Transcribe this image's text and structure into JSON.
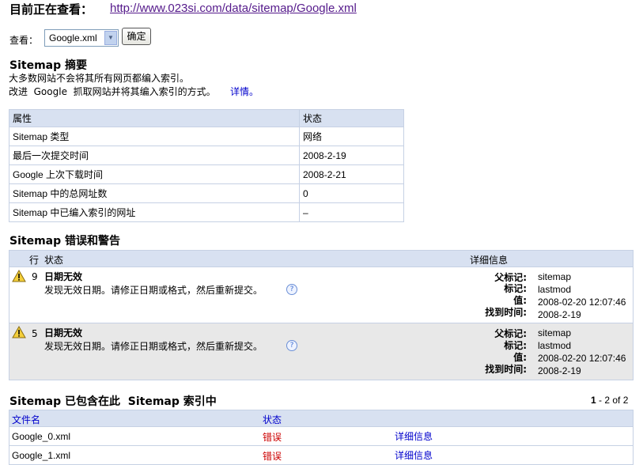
{
  "header": {
    "title": "目前正在查看：",
    "url": "http://www.023si.com/data/sitemap/Google.xml"
  },
  "view": {
    "label": "查看：",
    "selected": "Google.xml",
    "ok_label": "确定"
  },
  "summary": {
    "title": "Sitemap 摘要",
    "line1": "大多数网站不会将其所有网页都编入索引。",
    "line2": "改进  Google  抓取网站并将其编入索引的方式。",
    "details_link": "详情。",
    "headers": [
      "属性",
      "状态"
    ],
    "rows": [
      {
        "k": "Sitemap 类型",
        "v": "网络"
      },
      {
        "k": "最后一次提交时间",
        "v": "2008-2-19"
      },
      {
        "k": "Google 上次下载时间",
        "v": "2008-2-21"
      },
      {
        "k": "Sitemap 中的总网址数",
        "v": "0"
      },
      {
        "k": "Sitemap 中已编入索引的网址",
        "v": "–"
      }
    ]
  },
  "errors": {
    "title": "Sitemap 错误和警告",
    "headers": {
      "line": "行",
      "status": "状态",
      "details": "详细信息"
    },
    "labels": {
      "parent": "父标记:",
      "tag": "标记:",
      "value": "值:",
      "found": "找到时间:"
    },
    "items": [
      {
        "line": "9",
        "name": "日期无效",
        "desc": "发现无效日期。请修正日期或格式，然后重新提交。",
        "parent": "sitemap",
        "tag": "lastmod",
        "value": "2008-02-20 12:07:46",
        "found": "2008-2-19"
      },
      {
        "line": "5",
        "name": "日期无效",
        "desc": "发现无效日期。请修正日期或格式，然后重新提交。",
        "parent": "sitemap",
        "tag": "lastmod",
        "value": "2008-02-20 12:07:46",
        "found": "2008-2-19"
      }
    ]
  },
  "index": {
    "title": "Sitemap 已包含在此  Sitemap 索引中",
    "pager_bold": "1",
    "pager_rest": " - 2 of 2",
    "headers": {
      "file": "文件名",
      "status": "状态"
    },
    "rows": [
      {
        "file": "Google_0.xml",
        "status": "错误",
        "details": "详细信息"
      },
      {
        "file": "Google_1.xml",
        "status": "错误",
        "details": "详细信息"
      }
    ]
  }
}
